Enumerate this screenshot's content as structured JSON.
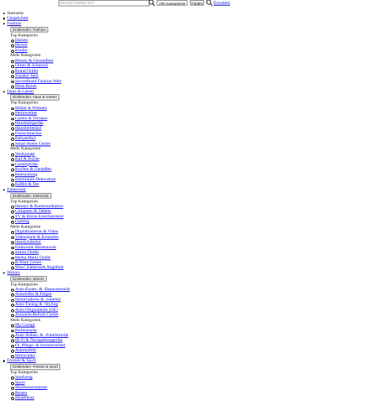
{
  "header": {
    "search_placeholder": "Wonach suchen Sie?",
    "category_select": "Alle Kategorien",
    "find_label": "Finden",
    "advanced_label": "Erweitert"
  },
  "nav": {
    "start": "Startseite",
    "saved": "Gespeichert",
    "fashion": {
      "label": "Fashion",
      "toggle": "Einblenden: Fashion",
      "top_title": "Top Kategorien",
      "top": [
        "Damen",
        "Herren",
        "Kinder"
      ],
      "more_title": "Mehr Kategorien",
      "more": [
        "Beauty & Gesundheit",
        "Uhren & Schmuck",
        "Brand Outlet",
        "Sneaker Spot",
        "Secondhand Fashion Welt",
        "Must-Haves"
      ]
    },
    "home": {
      "label": "Haus & Garten",
      "toggle": "Einblenden: Haus & Garten",
      "top_title": "Top Kategorien",
      "top": [
        "Möbel & Wohnen",
        "Heimwerker",
        "Garten & Terrasse",
        "Haushaltsgeräte",
        "Haustierbedarf",
        "Feinschmecker",
        "Babyartikel",
        "Smart Home Center"
      ],
      "more_title": "Mehr Kategorien",
      "more": [
        "Werkzeuge",
        "Bad & Küche",
        "Gartengeräte",
        "Kochen & Genießen",
        "Beleuchtung",
        "Innenraum-Dekoration",
        "Kaffee & Tee"
      ]
    },
    "electronics": {
      "label": "Elektronik",
      "toggle": "Einblenden: Elektronik",
      "top_title": "Top Kategorien",
      "top": [
        "Handys & Kommunikation",
        "Computer & Tablets",
        "TV & Home Entertainment",
        "Gaming"
      ],
      "more_title": "Mehr Kategorien",
      "more": [
        "Digitalkameras & Video",
        "Videospiele & Konsolen",
        "Handyzubehör",
        "Elektronik Markenwelt",
        "Saturn Outlet",
        "Media Markt Outlet",
        "B-Ware Center",
        "Wow! Elektronik Angebote"
      ]
    },
    "motors": {
      "label": "Motors",
      "toggle": "Einblenden: Motors",
      "top_title": "Top Kategorien",
      "top": [
        "Auto-Ersatz- & -Reparaturteile",
        "Autoreifen & Felgen",
        "Motorradteile & -zubehör",
        "Auto-Tuning & -Styling",
        "Auto-Originalteile (OE)",
        "Autoteile-Refurb-Center"
      ],
      "more_title": "Mehr Kategorien",
      "more": [
        "My Garage",
        "Reifensuche",
        "Auto-Anbau- & -Zubehörteile",
        "Hi-Fi & Navigationsgeräte",
        "Öl, Pflege- & Schmiermittel",
        "Automobile",
        "Motorräder"
      ]
    },
    "sport": {
      "label": "Freizeit & Sport",
      "toggle": "Einblenden: Freizeit & Sport",
      "top_title": "Top Kategorien",
      "top": [
        "Spielzeug",
        "Sport",
        "Musikinstrumente",
        "Reisen",
        "Modellbau"
      ]
    }
  }
}
